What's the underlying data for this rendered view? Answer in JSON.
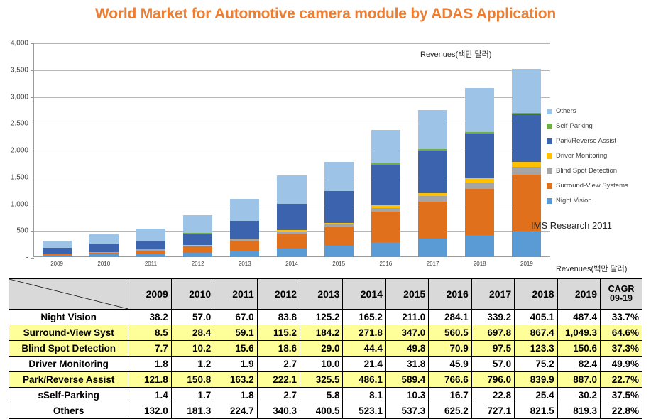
{
  "title": "World Market for Automotive camera module by ADAS Application",
  "title_color": "#ED7D31",
  "annotations": {
    "revenue_unit_chart": "Revenues(백만 달러)",
    "revenue_unit_table": "Revenues(백만 달러)",
    "source": "IMS Research 2011"
  },
  "legend": {
    "items": [
      {
        "label": "Others",
        "color": "#9DC3E6"
      },
      {
        "label": "Self-Parking",
        "color": "#70AD47"
      },
      {
        "label": "Park/Reverse Assist",
        "color": "#3C63AE"
      },
      {
        "label": "Driver Monitoring",
        "color": "#FFC000"
      },
      {
        "label": "Blind Spot Detection",
        "color": "#A5A5A5"
      },
      {
        "label": "Surround-View Systems",
        "color": "#E0701B"
      },
      {
        "label": "Night Vision",
        "color": "#5B9BD5"
      }
    ]
  },
  "chart_data": {
    "type": "bar",
    "subtype": "stacked-column",
    "title": "World Market for Automotive camera module by ADAS Application",
    "xlabel": "",
    "ylabel": "Revenues(백만 달러)",
    "ylim": [
      0,
      4000
    ],
    "ytick_values": [
      0,
      500,
      1000,
      1500,
      2000,
      2500,
      3000,
      3500,
      4000
    ],
    "ytick_labels": [
      "-",
      "500",
      "1,000",
      "1,500",
      "2,000",
      "2,500",
      "3,000",
      "3,500",
      "4,000"
    ],
    "grid": true,
    "legend_position": "right",
    "categories": [
      "2009",
      "2010",
      "2011",
      "2012",
      "2013",
      "2014",
      "2015",
      "2016",
      "2017",
      "2018",
      "2019"
    ],
    "stack_order_bottom_to_top": [
      "Night Vision",
      "Surround-View Systems",
      "Blind Spot Detection",
      "Driver Monitoring",
      "Park/Reverse Assist",
      "Self-Parking",
      "Others"
    ],
    "series": [
      {
        "name": "Night Vision",
        "color": "#5B9BD5",
        "values": [
          38.2,
          57.0,
          67.0,
          83.8,
          125.2,
          165.2,
          211.0,
          284.1,
          339.2,
          405.1,
          487.4
        ],
        "cagr": "33.7%"
      },
      {
        "name": "Surround-View Systems",
        "color": "#E0701B",
        "values": [
          8.5,
          28.4,
          59.1,
          115.2,
          184.2,
          271.8,
          347.0,
          560.5,
          697.8,
          867.4,
          1049.3
        ],
        "cagr": "64.6%"
      },
      {
        "name": "Blind Spot Detection",
        "color": "#A5A5A5",
        "values": [
          7.7,
          10.2,
          15.6,
          18.6,
          29.0,
          44.4,
          49.8,
          70.9,
          97.5,
          123.3,
          150.6
        ],
        "cagr": "37.3%"
      },
      {
        "name": "Driver Monitoring",
        "color": "#FFC000",
        "values": [
          1.8,
          1.2,
          1.9,
          2.7,
          10.0,
          21.4,
          31.8,
          45.9,
          57.0,
          75.2,
          82.4
        ],
        "cagr": "49.9%"
      },
      {
        "name": "Park/Reverse Assist",
        "color": "#3C63AE",
        "values": [
          121.8,
          150.8,
          163.2,
          222.1,
          325.5,
          486.1,
          589.4,
          766.6,
          796.0,
          839.9,
          887.0
        ],
        "cagr": "22.7%"
      },
      {
        "name": "Self-Parking",
        "color": "#70AD47",
        "values": [
          1.4,
          1.7,
          1.8,
          2.7,
          5.8,
          8.1,
          10.3,
          16.7,
          22.8,
          25.4,
          30.2
        ],
        "cagr": "37.5%"
      },
      {
        "name": "Others",
        "color": "#9DC3E6",
        "values": [
          132.0,
          181.3,
          224.7,
          340.3,
          400.5,
          523.1,
          537.3,
          625.2,
          727.1,
          821.5,
          819.3
        ],
        "cagr": "22.8%"
      }
    ]
  },
  "table": {
    "corner_label": "",
    "year_headers": [
      "2009",
      "2010",
      "2011",
      "2012",
      "2013",
      "2014",
      "2015",
      "2016",
      "2017",
      "2018",
      "2019"
    ],
    "cagr_header_line1": "CAGR",
    "cagr_header_line2": "09-19",
    "rows": [
      {
        "label": "Night Vision",
        "highlight": false,
        "values": [
          "38.2",
          "57.0",
          "67.0",
          "83.8",
          "125.2",
          "165.2",
          "211.0",
          "284.1",
          "339.2",
          "405.1",
          "487.4"
        ],
        "cagr": "33.7%"
      },
      {
        "label": "Surround-View Syst",
        "highlight": true,
        "values": [
          "8.5",
          "28.4",
          "59.1",
          "115.2",
          "184.2",
          "271.8",
          "347.0",
          "560.5",
          "697.8",
          "867.4",
          "1,049.3"
        ],
        "cagr": "64.6%"
      },
      {
        "label": "Blind Spot Detection",
        "highlight": true,
        "values": [
          "7.7",
          "10.2",
          "15.6",
          "18.6",
          "29.0",
          "44.4",
          "49.8",
          "70.9",
          "97.5",
          "123.3",
          "150.6"
        ],
        "cagr": "37.3%"
      },
      {
        "label": "Driver Monitoring",
        "highlight": false,
        "values": [
          "1.8",
          "1.2",
          "1.9",
          "2.7",
          "10.0",
          "21.4",
          "31.8",
          "45.9",
          "57.0",
          "75.2",
          "82.4"
        ],
        "cagr": "49.9%"
      },
      {
        "label": "Park/Reverse Assist",
        "highlight": true,
        "values": [
          "121.8",
          "150.8",
          "163.2",
          "222.1",
          "325.5",
          "486.1",
          "589.4",
          "766.6",
          "796.0",
          "839.9",
          "887.0"
        ],
        "cagr": "22.7%"
      },
      {
        "label": "sSelf-Parking",
        "highlight": false,
        "values": [
          "1.4",
          "1.7",
          "1.8",
          "2.7",
          "5.8",
          "8.1",
          "10.3",
          "16.7",
          "22.8",
          "25.4",
          "30.2"
        ],
        "cagr": "37.5%"
      },
      {
        "label": "Others",
        "highlight": false,
        "values": [
          "132.0",
          "181.3",
          "224.7",
          "340.3",
          "400.5",
          "523.1",
          "537.3",
          "625.2",
          "727.1",
          "821.5",
          "819.3"
        ],
        "cagr": "22.8%"
      }
    ]
  }
}
